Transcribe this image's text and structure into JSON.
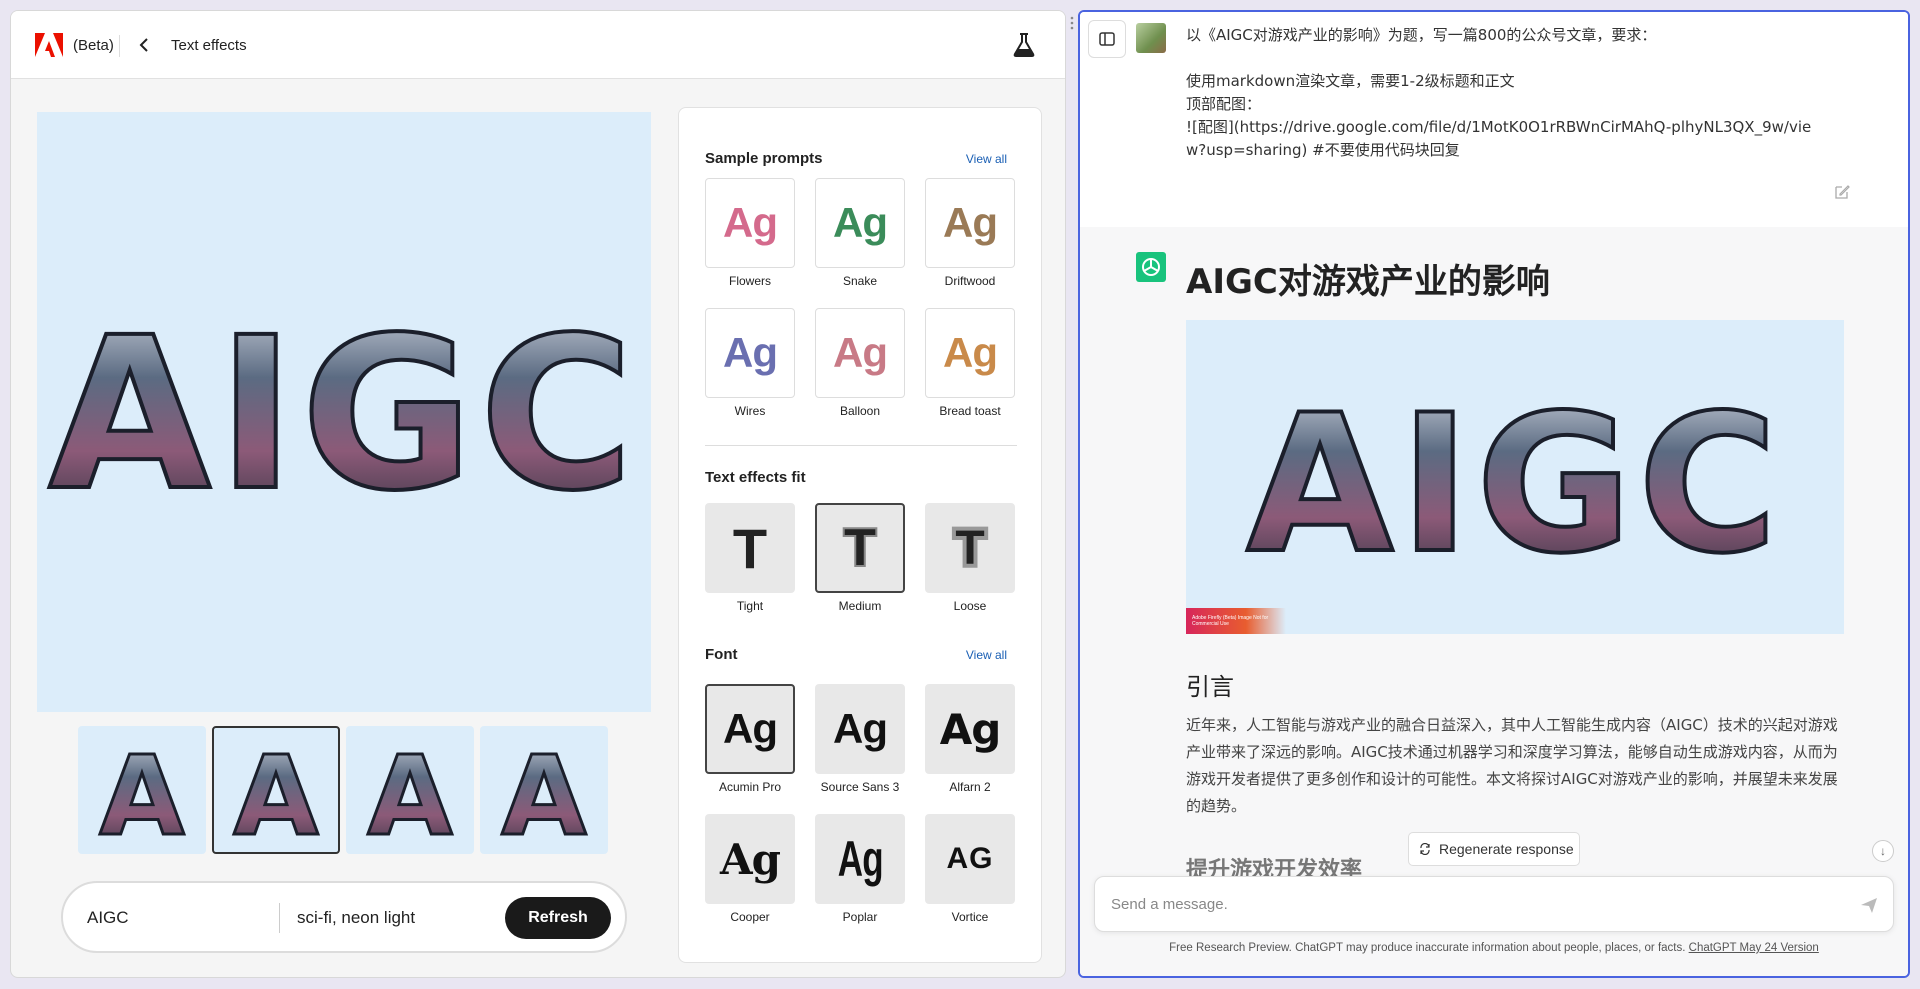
{
  "adobe": {
    "beta_label": "(Beta)",
    "page_title": "Text effects",
    "canvas_text": "AIGC",
    "thumb_letter": "A",
    "prompt_text": "AIGC",
    "prompt_style": "sci-fi, neon light",
    "refresh_label": "Refresh",
    "sample_prompts": {
      "title": "Sample prompts",
      "view_all": "View all",
      "items": [
        {
          "label": "Flowers",
          "glyph": "Ag",
          "color": "#d46a8c"
        },
        {
          "label": "Snake",
          "glyph": "Ag",
          "color": "#3b8c5a"
        },
        {
          "label": "Driftwood",
          "glyph": "Ag",
          "color": "#9a7a56"
        },
        {
          "label": "Wires",
          "glyph": "Ag",
          "color": "#6a6fb0"
        },
        {
          "label": "Balloon",
          "glyph": "Ag",
          "color": "#c87a86"
        },
        {
          "label": "Bread toast",
          "glyph": "Ag",
          "color": "#c98a4a"
        }
      ]
    },
    "text_effects_fit": {
      "title": "Text effects fit",
      "items": [
        {
          "label": "Tight",
          "glyph": "T"
        },
        {
          "label": "Medium",
          "glyph": "T"
        },
        {
          "label": "Loose",
          "glyph": "T"
        }
      ]
    },
    "font": {
      "title": "Font",
      "view_all": "View all",
      "items": [
        {
          "label": "Acumin Pro",
          "glyph": "Ag"
        },
        {
          "label": "Source Sans 3",
          "glyph": "Ag"
        },
        {
          "label": "Alfarn 2",
          "glyph": "Ag"
        },
        {
          "label": "Cooper",
          "glyph": "Ag"
        },
        {
          "label": "Poplar",
          "glyph": "Ag"
        },
        {
          "label": "Vortice",
          "glyph": "AG"
        }
      ]
    }
  },
  "chat": {
    "user_message": "以《AIGC对游戏产业的影响》为题，写一篇800的公众号文章，要求：\n\n使用markdown渲染文章，需要1-2级标题和正文\n顶部配图：\n![配图](https://drive.google.com/file/d/1MotK0O1rRBWnCirMAhQ-plhyNL3QX_9w/view?usp=sharing) #不要使用代码块回复",
    "answer_title": "AIGC对游戏产业的影响",
    "image_text": "AIGC",
    "image_stamp": "Adobe Firefly (Beta)\nImage Not for Commercial Use",
    "intro_heading": "引言",
    "intro_paragraph": "近年来，人工智能与游戏产业的融合日益深入，其中人工智能生成内容（AIGC）技术的兴起对游戏产业带来了深远的影响。AIGC技术通过机器学习和深度学习算法，能够自动生成游戏内容，从而为游戏开发者提供了更多创作和设计的可能性。本文将探讨AIGC对游戏产业的影响，并展望未来发展的趋势。",
    "next_heading": "提升游戏开发效率",
    "regenerate_label": "Regenerate response",
    "input_placeholder": "Send a message.",
    "footer_text": "Free Research Preview. ChatGPT may produce inaccurate information about people, places, or facts.",
    "footer_link": "ChatGPT May 24 Version"
  },
  "colors": {
    "canvas_bg": "#dcedfa",
    "chat_border": "#4a63e0",
    "gpt_green": "#19c37d",
    "refresh_bg": "#1a1a1a",
    "link_blue": "#1a5fb4"
  }
}
